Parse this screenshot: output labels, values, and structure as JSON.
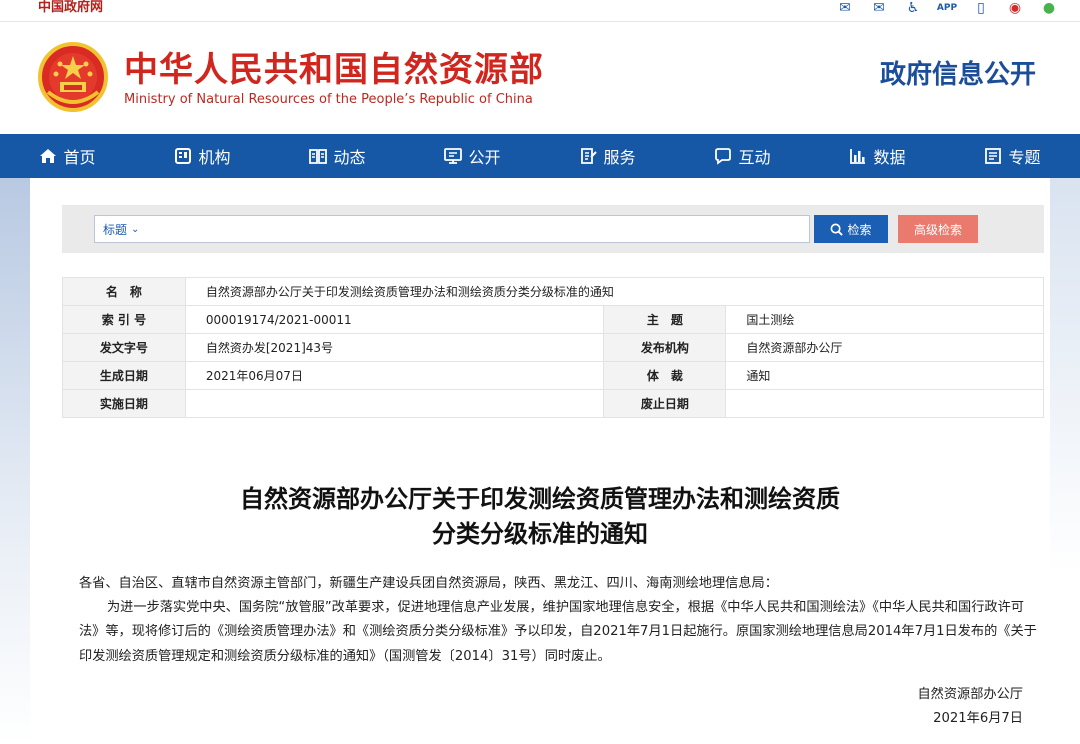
{
  "topbar": {
    "gov_link": "中国政府网",
    "icons": [
      "mail-icon",
      "mail-alt-icon",
      "accessibility-icon",
      "app-icon",
      "mobile-icon",
      "weibo-icon",
      "wechat-icon"
    ]
  },
  "header": {
    "title_cn": "中华人民共和国自然资源部",
    "title_en": "Ministry of Natural Resources of the People’s Republic of China",
    "right": "政府信息公开"
  },
  "nav": [
    {
      "label": "首页",
      "icon": "home-icon"
    },
    {
      "label": "机构",
      "icon": "org-icon"
    },
    {
      "label": "动态",
      "icon": "news-icon"
    },
    {
      "label": "公开",
      "icon": "public-icon"
    },
    {
      "label": "服务",
      "icon": "service-icon"
    },
    {
      "label": "互动",
      "icon": "chat-icon"
    },
    {
      "label": "数据",
      "icon": "chart-icon"
    },
    {
      "label": "专题",
      "icon": "topic-icon"
    }
  ],
  "search": {
    "field_select": "标题",
    "input_value": "",
    "search_label": "检索",
    "advanced_label": "高级检索"
  },
  "info": {
    "name_label": "名　称",
    "name_value": "自然资源部办公厅关于印发测绘资质管理办法和测绘资质分类分级标准的通知",
    "index_label": "索 引 号",
    "index_value": "000019174/2021-00011",
    "subject_label": "主　题",
    "subject_value": "国土测绘",
    "docno_label": "发文字号",
    "docno_value": "自然资办发[2021]43号",
    "publisher_label": "发布机构",
    "publisher_value": "自然资源部办公厅",
    "created_label": "生成日期",
    "created_value": "2021年06月07日",
    "genre_label": "体　裁",
    "genre_value": "通知",
    "effective_label": "实施日期",
    "effective_value": "",
    "expired_label": "废止日期",
    "expired_value": ""
  },
  "article": {
    "title_line1": "自然资源部办公厅关于印发测绘资质管理办法和测绘资质",
    "title_line2": "分类分级标准的通知",
    "salutation": "各省、自治区、直辖市自然资源主管部门，新疆生产建设兵团自然资源局，陕西、黑龙江、四川、海南测绘地理信息局：",
    "paragraph": "为进一步落实党中央、国务院“放管服”改革要求，促进地理信息产业发展，维护国家地理信息安全，根据《中华人民共和国测绘法》《中华人民共和国行政许可法》等，现将修订后的《测绘资质管理办法》和《测绘资质分类分级标准》予以印发，自2021年7月1日起施行。原国家测绘地理信息局2014年7月1日发布的《关于印发测绘资质管理规定和测绘资质分级标准的通知》（国测管发〔2014〕31号）同时废止。",
    "signer": "自然资源部办公厅",
    "date": "2021年6月7日"
  }
}
